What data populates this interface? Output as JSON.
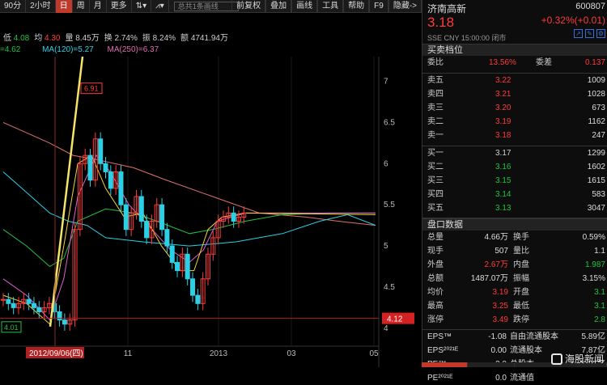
{
  "toolbar": {
    "items": [
      "90分",
      "2小时",
      "日",
      "周",
      "月",
      "更多"
    ],
    "active_index": 2,
    "right_items": [
      "前复权",
      "叠加",
      "画线",
      "工具",
      "帮助",
      "F9",
      "隐藏->"
    ],
    "search_placeholder": "总共1条画线"
  },
  "info": {
    "low_label": "低",
    "low_value": "4.08",
    "avg_label": "均",
    "avg_value": "4.30",
    "volume_label": "量",
    "volume_value": "8.45万",
    "turnover_label": "换",
    "turnover_value": "2.74%",
    "amplitude_label": "振",
    "amplitude_value": "8.24%",
    "amount_label": "额",
    "amount_value": "4741.94万"
  },
  "ma": [
    {
      "label": "=4.62",
      "color": "#21c241"
    },
    {
      "label": "MA(120)=5.27",
      "color": "#2ad0e6"
    },
    {
      "label": "MA(250)=6.37",
      "color": "#e06bb0"
    }
  ],
  "stock": {
    "name": "济南高新",
    "code": "600807",
    "price": "3.18",
    "change": "+0.32%(+0.01)",
    "meta": "SSE  CNY  15:00:00  闭市"
  },
  "order_book": {
    "title": "买卖档位",
    "ratio_label": "委比",
    "ratio_value": "13.56%",
    "diff_label": "委差",
    "diff_value": "0.137",
    "asks": [
      {
        "label": "卖五",
        "price": "3.22",
        "volume": "1009"
      },
      {
        "label": "卖四",
        "price": "3.21",
        "volume": "1028"
      },
      {
        "label": "卖三",
        "price": "3.20",
        "volume": "673"
      },
      {
        "label": "卖二",
        "price": "3.19",
        "volume": "1162"
      },
      {
        "label": "卖一",
        "price": "3.18",
        "volume": "247"
      }
    ],
    "bids": [
      {
        "label": "买一",
        "price": "3.17",
        "volume": "1299"
      },
      {
        "label": "买二",
        "price": "3.16",
        "volume": "1602"
      },
      {
        "label": "买三",
        "price": "3.15",
        "volume": "1615"
      },
      {
        "label": "买四",
        "price": "3.14",
        "volume": "583"
      },
      {
        "label": "买五",
        "price": "3.13",
        "volume": "3047"
      }
    ]
  },
  "detail": {
    "title": "盘口数据",
    "rows": [
      {
        "l1": "总量",
        "v1": "4.66万",
        "v1c": "#dddddd",
        "l2": "换手",
        "v2": "0.59%",
        "v2c": "#dddddd"
      },
      {
        "l1": "现手",
        "v1": "507",
        "v1c": "#dddddd",
        "l2": "量比",
        "v2": "1.1",
        "v2c": "#dddddd"
      },
      {
        "l1": "外盘",
        "v1": "2.67万",
        "v1c": "#ff3b3b",
        "l2": "内盘",
        "v2": "1.987",
        "v2c": "#21c241"
      },
      {
        "l1": "总额",
        "v1": "1487.07万",
        "v1c": "#dddddd",
        "l2": "振幅",
        "v2": "3.15%",
        "v2c": "#dddddd"
      },
      {
        "l1": "均价",
        "v1": "3.19",
        "v1c": "#ff3b3b",
        "l2": "开盘",
        "v2": "3.1",
        "v2c": "#21c241"
      },
      {
        "l1": "最高",
        "v1": "3.25",
        "v1c": "#ff3b3b",
        "l2": "最低",
        "v2": "3.1",
        "v2c": "#21c241"
      },
      {
        "l1": "涨停",
        "v1": "3.49",
        "v1c": "#ff3b3b",
        "l2": "跌停",
        "v2": "2.8",
        "v2c": "#21c241"
      }
    ]
  },
  "finance": [
    {
      "l1": "EPS™",
      "v1": "-1.08",
      "l2": "自由流通股本",
      "v2": "5.89亿"
    },
    {
      "l1": "EPS²⁰²¹ᴱ",
      "v1": "0.00",
      "l2": "流通股本",
      "v2": "7.87亿"
    },
    {
      "l1": "PE™",
      "v1": "-3.0",
      "l2": "总股本",
      "v2": "8.85亿"
    },
    {
      "l1": "PE²⁰²¹ᴱ",
      "v1": "0.0",
      "l2": "流通值",
      "v2": ""
    }
  ],
  "watermark": "海股新闻",
  "chart_data": {
    "type": "candlestick",
    "y_ticks": [
      "7",
      "6.5",
      "6",
      "5.5",
      "5",
      "4.5",
      "4"
    ],
    "ylim": [
      3.9,
      7.3
    ],
    "x_ticks": [
      "11",
      "2013",
      "03",
      "05"
    ],
    "date_label": "2012/09/06(四)",
    "high_label": "6.91",
    "low_label": "4.01",
    "current_price_label": "4.12",
    "current_price": 4.12,
    "colors": {
      "up": "#ff3b3b",
      "down": "#2ad0e6",
      "ma5": "#ffffff",
      "ma10": "#f5d33a",
      "ma20": "#e060d0",
      "ma60": "#21c241",
      "ma120": "#2ad0e6",
      "ma250": "#e07070"
    }
  }
}
